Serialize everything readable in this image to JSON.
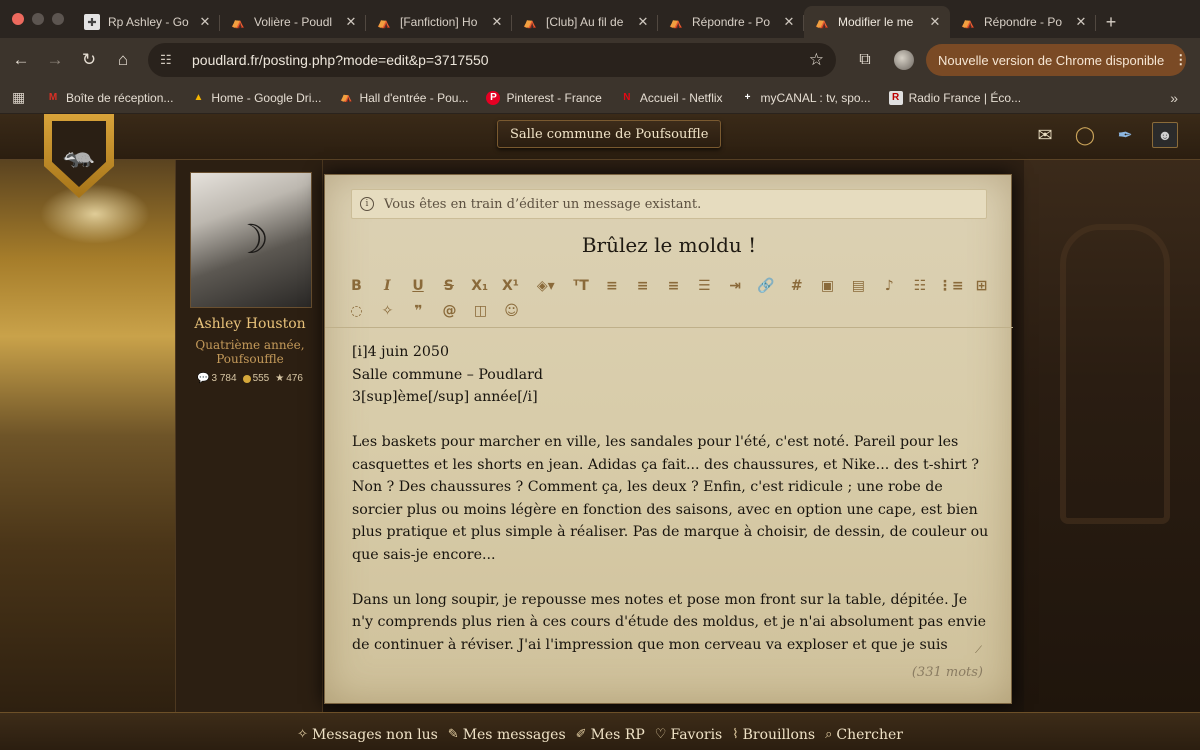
{
  "browser": {
    "tabs": [
      {
        "label": "Rp Ashley - Go",
        "favicon": "plus-box-icon",
        "active": false
      },
      {
        "label": "Volière - Poudl",
        "favicon": "hat-icon",
        "active": false
      },
      {
        "label": "[Fanfiction] Ho",
        "favicon": "hat-icon",
        "active": false
      },
      {
        "label": "[Club] Au fil de",
        "favicon": "hat-icon",
        "active": false
      },
      {
        "label": "Répondre - Po",
        "favicon": "hat-icon",
        "active": false
      },
      {
        "label": "Modifier le me",
        "favicon": "hat-icon",
        "active": true
      },
      {
        "label": "Répondre - Po",
        "favicon": "hat-icon",
        "active": false
      }
    ],
    "url": "poudlard.fr/posting.php?mode=edit&p=3717550",
    "update_label": "Nouvelle version de Chrome disponible",
    "bookmarks": [
      {
        "label": "Boîte de réception...",
        "icon": "gmail-icon",
        "color": "#d93025",
        "glyph": "M"
      },
      {
        "label": "Home - Google Dri...",
        "icon": "google-drive-icon",
        "color": "#34a853",
        "glyph": "▲"
      },
      {
        "label": "Hall d'entrée - Pou...",
        "icon": "hat-icon",
        "color": "#bca98c",
        "glyph": "⛺"
      },
      {
        "label": "Pinterest - France",
        "icon": "pinterest-icon",
        "color": "#e60023",
        "glyph": "P"
      },
      {
        "label": "Accueil - Netflix",
        "icon": "netflix-icon",
        "color": "#e50914",
        "glyph": "N"
      },
      {
        "label": "myCANAL : tv, spo...",
        "icon": "canal-icon",
        "color": "#ffffff",
        "glyph": "+"
      },
      {
        "label": "Radio France | Éco...",
        "icon": "radio-france-icon",
        "color": "#e0e0e0",
        "glyph": "R"
      }
    ]
  },
  "site": {
    "location": "Salle commune de Poufsouffle",
    "author": {
      "name": "Ashley Houston",
      "rank": "Quatrième année, Poufsouffle",
      "messages": "3 784",
      "points": "555",
      "stars": "476"
    },
    "info_message": "Vous êtes en train d’éditer un message existant.",
    "post_title": "Brûlez le moldu !",
    "editor_lines": [
      "[i]4 juin 2050",
      "Salle commune – Poudlard",
      "3[sup]ème[/sup] année[/i]"
    ],
    "editor_paragraphs": [
      "Les baskets pour marcher en ville, les sandales pour l'été, c'est noté. Pareil pour les casquettes et les shorts en jean. Adidas ça fait... des chaussures, et Nike... des t-shirt ? Non ? Des chaussures ? Comment ça, les deux ? Enfin, c'est ridicule ; une robe de sorcier plus ou moins légère en fonction des saisons, avec en option une cape, est bien plus pratique et plus simple à réaliser. Pas de marque à choisir, de dessin, de couleur ou que sais-je encore...",
      "Dans un long soupir, je repousse mes notes et pose mon front sur la table, dépitée. Je n'y comprends plus rien à ces cours d'étude des moldus, et je n'ai absolument pas envie de continuer à réviser. J'ai l'impression que mon cerveau va exploser et que je suis incapable de retenir quoique ce soit hormis la façon d'utiliser un stylo quatre couleurs. C'est pitoyable. Et le"
    ],
    "word_count": "(331 mots)",
    "bottom_nav": [
      {
        "label": "Messages non lus",
        "icon": "sparkle-icon"
      },
      {
        "label": "Mes messages",
        "icon": "quill-icon"
      },
      {
        "label": "Mes RP",
        "icon": "feather-icon"
      },
      {
        "label": "Favoris",
        "icon": "heart-icon"
      },
      {
        "label": "Brouillons",
        "icon": "scroll-icon"
      },
      {
        "label": "Chercher",
        "icon": "search-icon"
      }
    ]
  }
}
